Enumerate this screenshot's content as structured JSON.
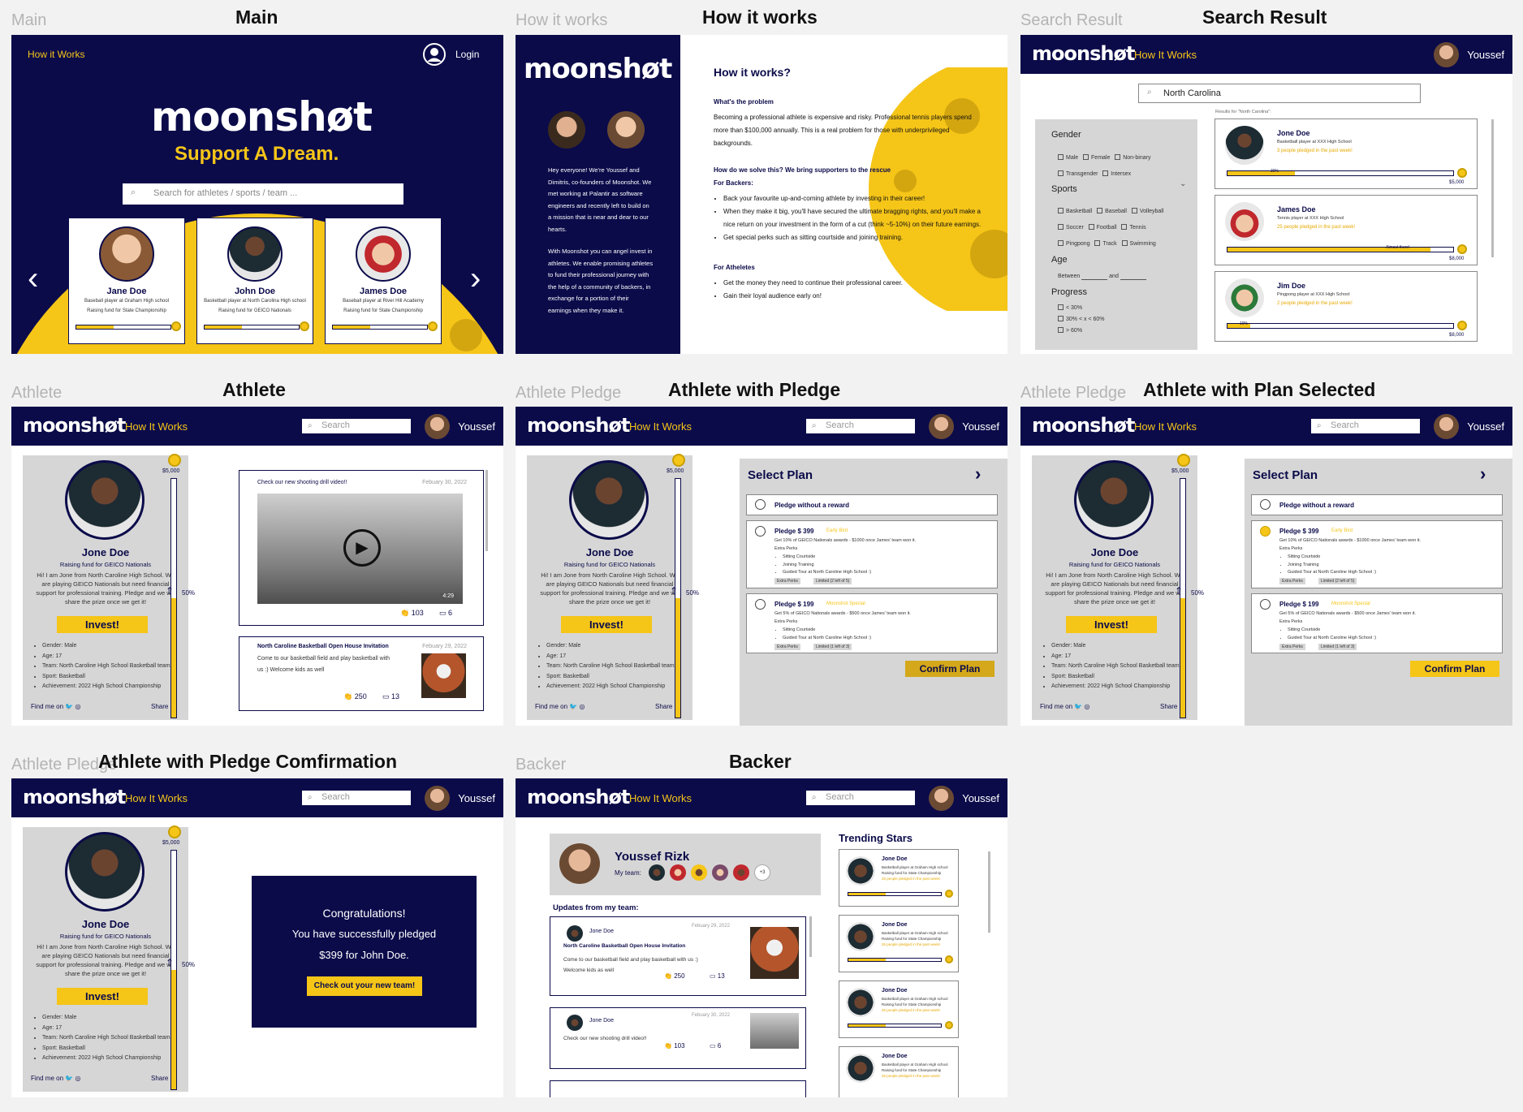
{
  "labels": {
    "main": {
      "gray": "Main",
      "bold": "Main"
    },
    "how": {
      "gray": "How it works",
      "bold": "How it works"
    },
    "search": {
      "gray": "Search Result",
      "bold": "Search Result"
    },
    "athlete": {
      "gray": "Athlete",
      "bold": "Athlete"
    },
    "pledge": {
      "gray": "Athlete Pledge",
      "bold": "Athlete with Pledge"
    },
    "plan": {
      "gray": "Athlete Pledge",
      "bold": "Athlete with Plan Selected"
    },
    "confirm": {
      "gray": "Athlete Pledge",
      "bold": "Athlete with Pledge Comfirmation"
    },
    "backer": {
      "gray": "Backer",
      "bold": "Backer"
    }
  },
  "common": {
    "logo": "moonshøt",
    "how_it_works": "How It Works",
    "search_placeholder": "Search",
    "username": "Youssef"
  },
  "main": {
    "nav_link": "How it Works",
    "login": "Login",
    "tagline": "Support A Dream.",
    "search_placeholder": "Search for athletes / sports / team ...",
    "cards": [
      {
        "name": "Jane Doe",
        "desc": "Baseball player at Graham High school",
        "goal": "Raising fund for State Championship"
      },
      {
        "name": "John Doe",
        "desc": "Basketball player at North Carolina High school",
        "goal": "Raising fund for GEICO Nationals"
      },
      {
        "name": "James Doe",
        "desc": "Baseball player at River Hill Academy",
        "goal": "Raising fund for State Championship"
      }
    ]
  },
  "how": {
    "intro": "Hey everyone! We're Youssef and Dimitris, co-founders of Moonshot. We met working at Palantir as software engineers and recently left to build on a mission that is near and dear to our hearts.",
    "intro2": "With Moonshot you can angel invest in athletes. We enable promising athletes to fund their professional journey with the help of a community of backers, in exchange for a portion of their earnings when they make it.",
    "title": "How it works?",
    "problem_h": "What's the problem",
    "problem": "Becoming a professional athlete is expensive and risky. Professional tennis players spend more than $100,000 annually. This is a real problem for those with underprivileged backgrounds.",
    "solve_h": "How do we solve this? We bring supporters to the rescue",
    "backers_h": "For Backers:",
    "backers": [
      "Back your favourite up-and-coming athlete by investing in their career!",
      "When they make it big, you'll have secured the ultimate bragging rights, and you'll make a nice return on your investment in the form of a cut (think ~5-10%) on their future earnings.",
      "Get special perks such as sitting courtside and joining training."
    ],
    "athletes_h": "For Atheletes",
    "athletes": [
      "Get the money they need to continue their professional career.",
      "Gain their loyal audience early on!"
    ]
  },
  "search": {
    "query": "North Carolina",
    "results_label": "Results for \"North Carolina\":",
    "gender_h": "Gender",
    "gender": [
      "Male",
      "Female",
      "Non-binary",
      "Transgender",
      "Intersex"
    ],
    "sports_h": "Sports",
    "sports": [
      "Basketball",
      "Baseball",
      "Volleyball",
      "Soccer",
      "Football",
      "Tennis",
      "Pingpong",
      "Track",
      "Swimming"
    ],
    "age_h": "Age",
    "age_between": "Between",
    "age_and": "and",
    "progress_h": "Progress",
    "progress": [
      "< 30%",
      "30% < x < 60%",
      "> 60%"
    ],
    "results": [
      {
        "name": "Jone Doe",
        "desc": "Basketball player at XXX High School",
        "pledged": "3 people pledged in the past week!",
        "bar_label": "30%",
        "fill": 0.3,
        "goal": "$5,000"
      },
      {
        "name": "James Doe",
        "desc": "Tennis player at XXX High School",
        "pledged": "25 people pledged in the past week!",
        "bar_label": "Almost there!",
        "fill": 0.9,
        "goal": "$8,000"
      },
      {
        "name": "Jim Doe",
        "desc": "Pingpong player at XXX High School",
        "pledged": "2 people pledged in the past week!",
        "bar_label": "10%",
        "fill": 0.1,
        "goal": "$8,000"
      }
    ]
  },
  "athlete": {
    "name": "Jone Doe",
    "goal": "Raising fund for GEICO Nationals",
    "bio": "Hi! I am Jone from North Caroline High School. We are playing GEICO Nationals but need financial support for professional training. Pledge and we will share the prize once we get it!",
    "invest": "Invest!",
    "facts": [
      "Gender: Male",
      "Age: 17",
      "Team: North Caroline High School Basketball team",
      "Sport: Basketball",
      "Achievement: 2022 High School Championship"
    ],
    "find_me": "Find me on",
    "share": "Share",
    "goal_amount": "$5,000",
    "progress_label": "50%",
    "progress": 0.5,
    "posts": [
      {
        "title": "Check our new shooting drill video!!",
        "date": "Febuary 30, 2022",
        "duration": "4:29",
        "claps": "103",
        "comments": "6"
      },
      {
        "title": "North Caroline Basketball Open House Invitation",
        "date": "Febuary 29, 2022",
        "body": "Come to our basketball field and play basketball with us :) Welcome kids as well",
        "claps": "250",
        "comments": "13"
      }
    ]
  },
  "plan": {
    "title": "Select Plan",
    "no_reward": "Pledge without a reward",
    "plans": [
      {
        "price": "Pledge $ 399",
        "tag": "Early Bird",
        "desc": "Get 10% of GEICO Nationals awards - $1000 once James' team won it.",
        "perks_h": "Extra Perks",
        "perks": [
          "Sitting Courtside",
          "Joining Training",
          "Guided Tour at North Caroline High School :)"
        ],
        "chips": [
          "Extra Perks",
          "Limited (2 left of 5)"
        ]
      },
      {
        "price": "Pledge $ 199",
        "tag": "Moonshot Special",
        "desc": "Get 5% of GEICO Nationals awards - $500 once James' team won it.",
        "perks_h": "Extra Perks",
        "perks": [
          "Sitting Courtside",
          "Guided Tour at North Caroline High School :)"
        ],
        "chips": [
          "Extra Perks",
          "Limited (1 left of 3)"
        ]
      }
    ],
    "confirm": "Confirm Plan"
  },
  "confirm": {
    "line1": "Congratulations!",
    "line2": "You have successfully pledged",
    "line3": "$399 for John Doe.",
    "button": "Check out your new team!"
  },
  "backer": {
    "name": "Youssef Rizk",
    "my_team": "My team:",
    "more": "+3",
    "updates_h": "Updates from my team:",
    "updates": [
      {
        "author": "Jone Doe",
        "date": "Febuary 29, 2022",
        "title": "North Caroline Basketball Open House Invitation",
        "body": "Come to our basketball field and play basketball with us :) Welcome kids as well",
        "claps": "250",
        "comments": "13"
      },
      {
        "author": "Jone Doe",
        "date": "Febuary 30, 2022",
        "title": "",
        "body": "Check our new shooting drill video!!",
        "claps": "103",
        "comments": "6"
      }
    ],
    "trending_h": "Trending Stars",
    "trending": [
      {
        "name": "Jone Doe",
        "l1": "Basketball player at Graham High school",
        "l2": "Raising fund for State Championship",
        "l3": "25 people pledged in the past week!"
      },
      {
        "name": "Jone Doe",
        "l1": "Basketball player at Graham High school",
        "l2": "Raising fund for State Championship",
        "l3": "25 people pledged in the past week!"
      },
      {
        "name": "Jone Doe",
        "l1": "Basketball player at Graham High school",
        "l2": "Raising fund for State Championship",
        "l3": "25 people pledged in the past week!"
      },
      {
        "name": "Jone Doe",
        "l1": "Basketball player at Graham High school",
        "l2": "Raising fund for State Championship",
        "l3": "25 people pledged in the past week!"
      }
    ]
  }
}
